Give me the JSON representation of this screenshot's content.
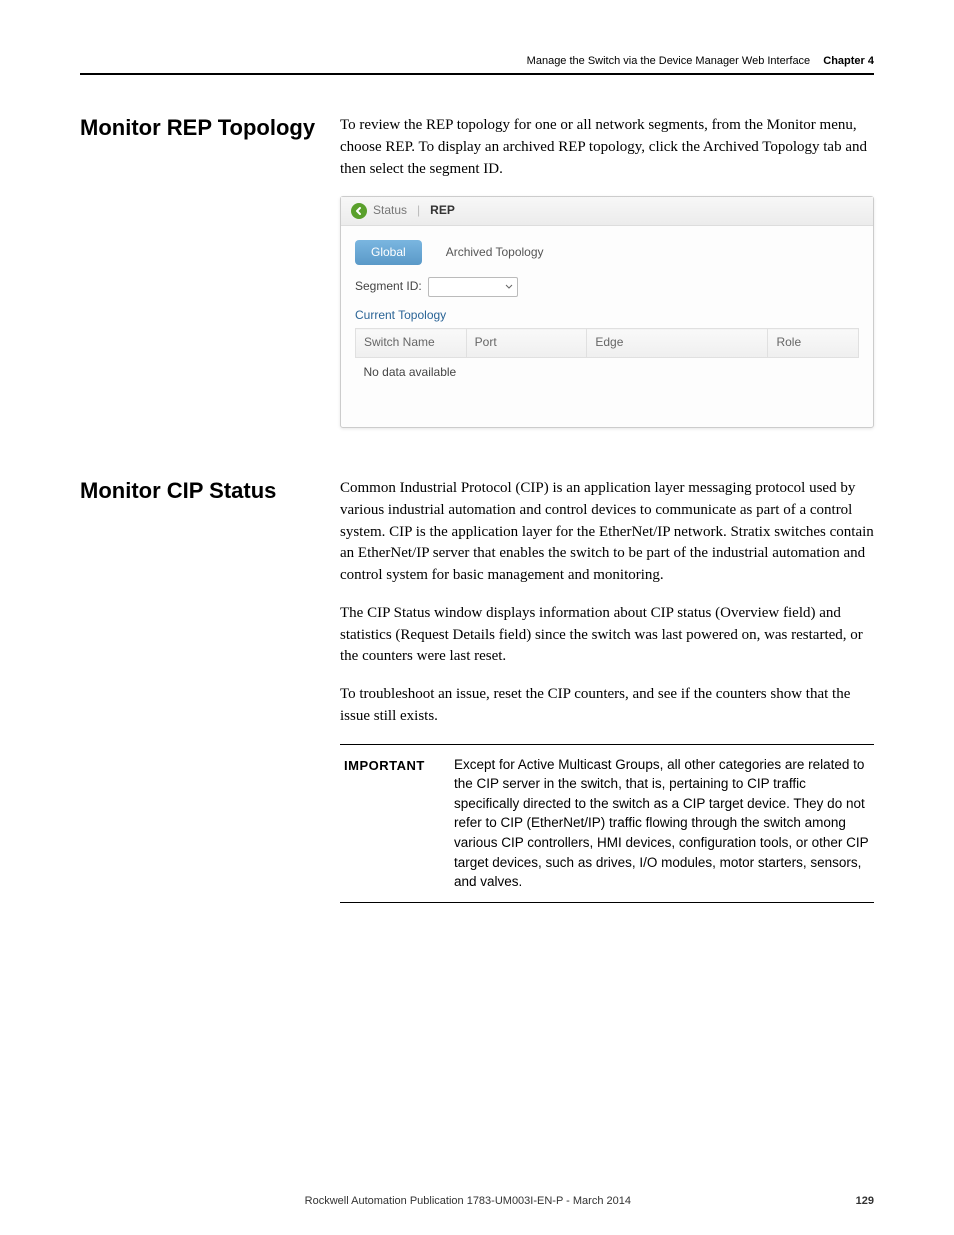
{
  "header": {
    "title": "Manage the Switch via the Device Manager Web Interface",
    "chapter": "Chapter 4"
  },
  "section1": {
    "heading": "Monitor REP Topology",
    "para1": "To review the REP topology for one or all network segments, from the Monitor menu, choose REP. To display an archived REP topology, click the Archived Topology tab and then select the segment ID."
  },
  "panel": {
    "crumb_status": "Status",
    "crumb_current": "REP",
    "tab_global": "Global",
    "tab_archived": "Archived Topology",
    "segment_label": "Segment ID:",
    "current_topology": "Current Topology",
    "col_switch": "Switch Name",
    "col_port": "Port",
    "col_edge": "Edge",
    "col_role": "Role",
    "no_data": "No data available"
  },
  "section2": {
    "heading": "Monitor CIP Status",
    "para1": "Common Industrial Protocol (CIP) is an application layer messaging protocol used by various industrial automation and control devices to communicate as part of a control system. CIP is the application layer for the EtherNet/IP network. Stratix switches contain an EtherNet/IP server that enables the switch to be part of the industrial automation and control system for basic management and monitoring.",
    "para2": "The CIP Status window displays information about CIP status (Overview field) and statistics (Request Details field) since the switch was last powered on, was restarted, or the counters were last reset.",
    "para3": "To troubleshoot an issue, reset the CIP counters, and see if the counters show that the issue still exists."
  },
  "important": {
    "label": "IMPORTANT",
    "text": "Except for Active Multicast Groups, all other categories are related to the CIP server in the switch, that is, pertaining to CIP traffic specifically directed to the switch as a CIP target device. They do not refer to CIP (EtherNet/IP) traffic flowing through the switch among various CIP controllers, HMI devices, configuration tools, or other CIP target devices, such as drives, I/O modules, motor starters, sensors, and valves."
  },
  "footer": {
    "pub": "Rockwell Automation Publication 1783-UM003I-EN-P - March 2014",
    "page": "129"
  }
}
